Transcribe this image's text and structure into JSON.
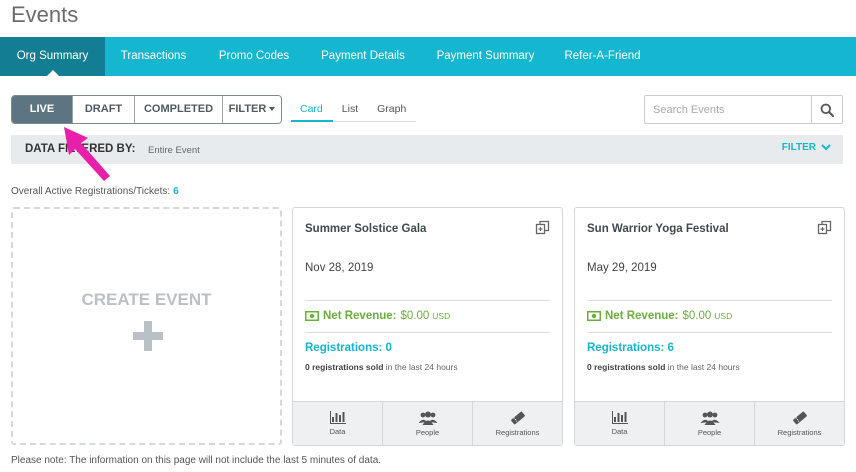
{
  "page": {
    "title": "Events"
  },
  "tabs": [
    {
      "label": "Org Summary",
      "active": true
    },
    {
      "label": "Transactions"
    },
    {
      "label": "Promo Codes"
    },
    {
      "label": "Payment Details"
    },
    {
      "label": "Payment Summary"
    },
    {
      "label": "Refer-A-Friend"
    }
  ],
  "status_filter": {
    "live": "LIVE",
    "draft": "DRAFT",
    "completed": "COMPLETED",
    "filter": "FILTER"
  },
  "views": {
    "card": "Card",
    "list": "List",
    "graph": "Graph",
    "selected": "Card"
  },
  "search": {
    "placeholder": "Search Events"
  },
  "filter_bar": {
    "label": "DATA FILTERED BY:",
    "value": "Entire Event",
    "filter_label": "FILTER"
  },
  "overall": {
    "label": "Overall Active Registrations/Tickets:",
    "count": "6"
  },
  "create_event": {
    "label": "CREATE EVENT"
  },
  "events": [
    {
      "title": "Summer Solstice Gala",
      "date": "Nov 28, 2019",
      "revenue_label": "Net Revenue:",
      "revenue_value": "$0.00",
      "currency": "USD",
      "registrations": "Registrations: 0",
      "sold_bold": "0 registrations sold",
      "sold_rest": " in the last 24 hours",
      "footer": {
        "data": "Data",
        "people": "People",
        "registrations": "Registrations"
      }
    },
    {
      "title": "Sun Warrior Yoga Festival",
      "date": "May 29, 2019",
      "revenue_label": "Net Revenue:",
      "revenue_value": "$0.00",
      "currency": "USD",
      "registrations": "Registrations: 6",
      "sold_bold": "0 registrations sold",
      "sold_rest": " in the last 24 hours",
      "footer": {
        "data": "Data",
        "people": "People",
        "registrations": "Registrations"
      }
    }
  ],
  "note": "Please note: The information on this page will not include the last 5 minutes of data.",
  "colors": {
    "accent": "#15b6cf",
    "tab_active": "#137e93",
    "revenue": "#6aae3c",
    "highlight_arrow": "#e81fa8"
  }
}
